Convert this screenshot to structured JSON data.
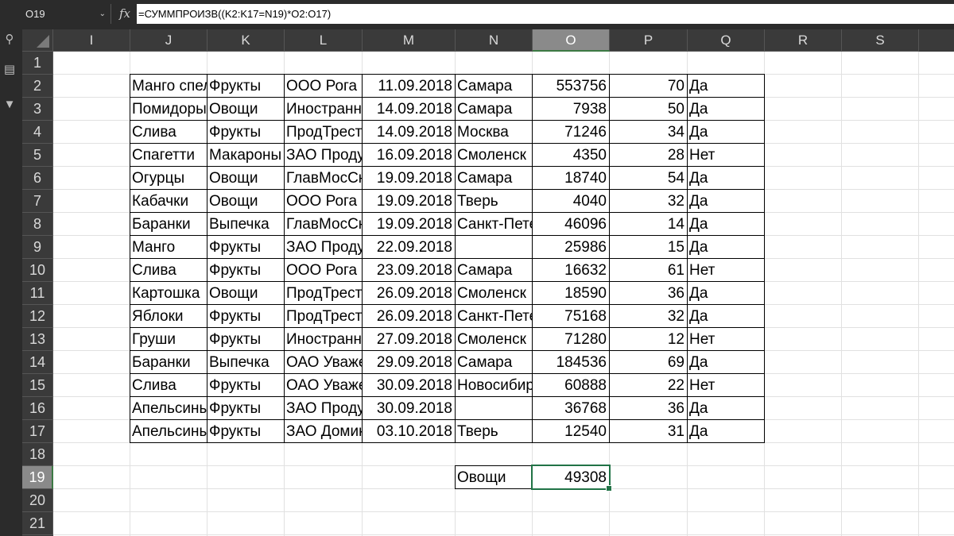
{
  "formula_bar": {
    "name_box": "O19",
    "fx_label": "fx",
    "formula": "=СУММПРОИЗВ((K2:K17=N19)*O2:O17)"
  },
  "columns": [
    "I",
    "J",
    "K",
    "L",
    "M",
    "N",
    "O",
    "P",
    "Q",
    "R",
    "S"
  ],
  "selected_column": "O",
  "rows": [
    "1",
    "2",
    "3",
    "4",
    "5",
    "6",
    "7",
    "8",
    "9",
    "10",
    "11",
    "12",
    "13",
    "14",
    "15",
    "16",
    "17",
    "18",
    "19",
    "20",
    "21"
  ],
  "selected_row": "19",
  "table": [
    [
      "Манго спелое",
      "Фрукты",
      "ООО Рога",
      "11.09.2018",
      "Самара",
      "553756",
      "70",
      "Да"
    ],
    [
      "Помидоры",
      "Овощи",
      "Иностранные",
      "14.09.2018",
      "Самара",
      "7938",
      "50",
      "Да"
    ],
    [
      "Слива",
      "Фрукты",
      "ПродТрест",
      "14.09.2018",
      "Москва",
      "71246",
      "34",
      "Да"
    ],
    [
      "Спагетти",
      "Макароны",
      "ЗАО Продукты",
      "16.09.2018",
      "Смоленск",
      "4350",
      "28",
      "Нет"
    ],
    [
      "Огурцы",
      "Овощи",
      "ГлавМосСнаб",
      "19.09.2018",
      "Самара",
      "18740",
      "54",
      "Да"
    ],
    [
      "Кабачки",
      "Овощи",
      "ООО Рога",
      "19.09.2018",
      "Тверь",
      "4040",
      "32",
      "Да"
    ],
    [
      "Баранки",
      "Выпечка",
      "ГлавМосСнаб",
      "19.09.2018",
      "Санкт-Петербург",
      "46096",
      "14",
      "Да"
    ],
    [
      "Манго",
      "Фрукты",
      "ЗАО Продукты",
      "22.09.2018",
      "",
      "25986",
      "15",
      "Да"
    ],
    [
      "Слива",
      "Фрукты",
      "ООО Рога",
      "23.09.2018",
      "Самара",
      "16632",
      "61",
      "Нет"
    ],
    [
      "Картошка",
      "Овощи",
      "ПродТрест",
      "26.09.2018",
      "Смоленск",
      "18590",
      "36",
      "Да"
    ],
    [
      "Яблоки",
      "Фрукты",
      "ПродТрест",
      "26.09.2018",
      "Санкт-Петербург",
      "75168",
      "32",
      "Да"
    ],
    [
      "Груши",
      "Фрукты",
      "Иностранные",
      "27.09.2018",
      "Смоленск",
      "71280",
      "12",
      "Нет"
    ],
    [
      "Баранки",
      "Выпечка",
      "ОАО Уважение",
      "29.09.2018",
      "Самара",
      "184536",
      "69",
      "Да"
    ],
    [
      "Слива",
      "Фрукты",
      "ОАО Уважение",
      "30.09.2018",
      "Новосибирск",
      "60888",
      "22",
      "Нет"
    ],
    [
      "Апельсины",
      "Фрукты",
      "ЗАО Продукты",
      "30.09.2018",
      "",
      "36768",
      "36",
      "Да"
    ],
    [
      "Апельсины",
      "Фрукты",
      "ЗАО Домик",
      "03.10.2018",
      "Тверь",
      "12540",
      "31",
      "Да"
    ]
  ],
  "criteria": {
    "label": "Овощи",
    "result": "49308"
  },
  "icons": [
    "search-icon",
    "comments-icon",
    "filter-icon"
  ]
}
